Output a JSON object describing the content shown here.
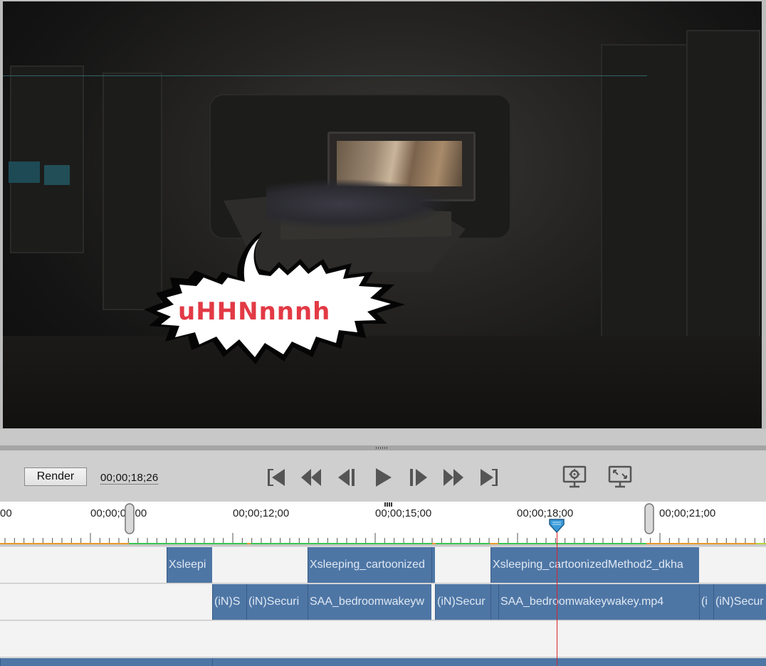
{
  "preview": {
    "caption_text": "uHHNnnnh"
  },
  "controls": {
    "render_label": "Render",
    "timecode": "00;00;18;26",
    "buttons": [
      {
        "name": "go-to-start",
        "icon": "skip-to-start-icon"
      },
      {
        "name": "previous-edit",
        "icon": "rewind-icon"
      },
      {
        "name": "step-back",
        "icon": "step-back-icon"
      },
      {
        "name": "play",
        "icon": "play-icon"
      },
      {
        "name": "step-forward",
        "icon": "step-forward-icon"
      },
      {
        "name": "next-edit",
        "icon": "fast-forward-icon"
      },
      {
        "name": "go-to-end",
        "icon": "skip-to-end-icon"
      },
      {
        "name": "preview-settings",
        "icon": "monitor-gear-icon"
      },
      {
        "name": "fullscreen-preview",
        "icon": "monitor-expand-icon"
      }
    ]
  },
  "ruler": {
    "labels": [
      "00",
      "00;00;09;00",
      "00;00;12;00",
      "00;00;15;00",
      "00;00;18;00",
      "00;00;21;00"
    ],
    "colors": {
      "render_bar": "#e89a2c",
      "rendered": "#3cc552",
      "playhead": "#d8232a"
    }
  },
  "tracks": {
    "track1": [
      "Xsleepi",
      "Xsleeping_cartoonized",
      "Xsleeping_cartoonizedMethod2_dkha"
    ],
    "track2": [
      "(iN)S",
      "(iN)Securi",
      "SAA_bedroomwakeyw",
      "(iN)Secur",
      "SAA_bedroomwakeywakey.mp4",
      "(i",
      "(iN)Secur"
    ]
  },
  "colors": {
    "clip": "#4e76a5",
    "clip_text": "#dfe8f3"
  }
}
